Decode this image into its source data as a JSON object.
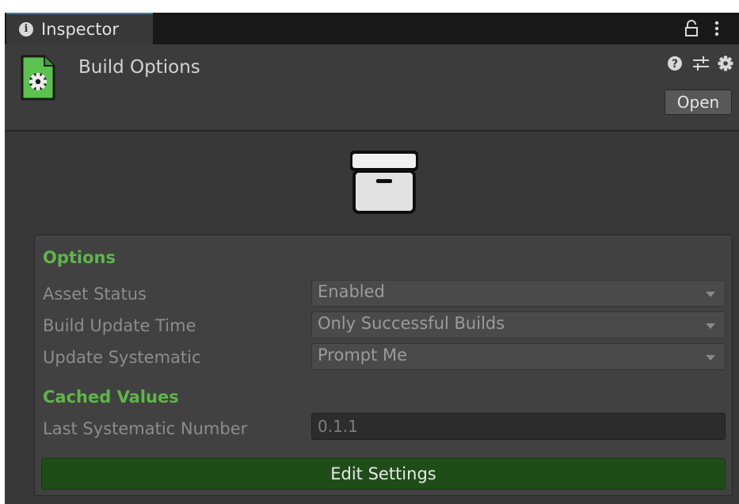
{
  "tab": {
    "label": "Inspector"
  },
  "header": {
    "title": "Build Options",
    "open_label": "Open"
  },
  "options": {
    "section_label": "Options",
    "asset_status": {
      "label": "Asset Status",
      "value": "Enabled"
    },
    "build_update_time": {
      "label": "Build Update Time",
      "value": "Only Successful Builds"
    },
    "update_systematic": {
      "label": "Update Systematic",
      "value": "Prompt Me"
    }
  },
  "cached": {
    "section_label": "Cached Values",
    "last_systematic_number": {
      "label": "Last Systematic Number",
      "value": "0.1.1"
    }
  },
  "actions": {
    "edit_settings_label": "Edit Settings"
  },
  "icons": {
    "tab": "info-icon",
    "lock": "lock-icon",
    "menu": "kebab-menu-icon",
    "asset": "settings-asset-icon",
    "help": "help-icon",
    "preset": "presets-icon",
    "settings": "gear-icon",
    "preview": "archive-box-icon",
    "dropdown": "dropdown-arrow-icon"
  },
  "colors": {
    "accent_tab": "#3a79bb",
    "section_green": "#5fb54a",
    "button_green": "#1f4d18",
    "asset_icon_green": "#5bc24f",
    "background": "#383838"
  }
}
